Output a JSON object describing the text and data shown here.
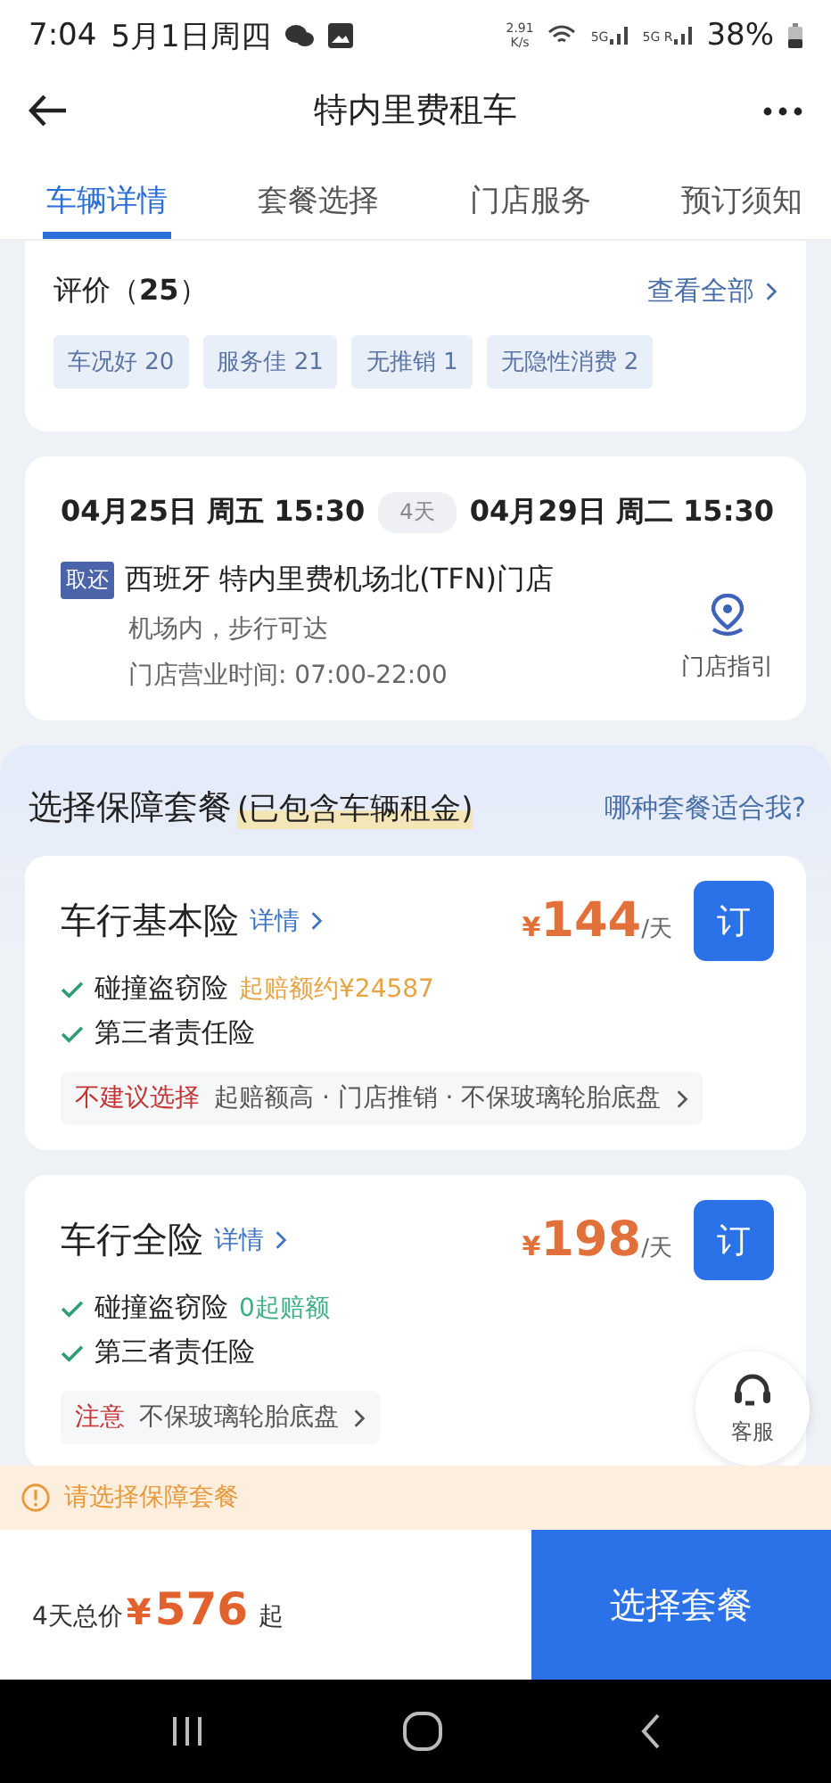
{
  "status_bar": {
    "time": "7:04",
    "date": "5月1日周四",
    "net_speed": [
      "2.91",
      "K/s"
    ],
    "signal_labels": [
      "5G",
      "5G R"
    ],
    "battery": "38%"
  },
  "header": {
    "title": "特内里费租车"
  },
  "tabs": [
    {
      "label": "车辆详情",
      "selected": true
    },
    {
      "label": "套餐选择",
      "selected": false
    },
    {
      "label": "门店服务",
      "selected": false
    },
    {
      "label": "预订须知",
      "selected": false
    }
  ],
  "reviews": {
    "title": "评价（**25**）",
    "view_all": "查看全部",
    "tags": [
      "车况好 20",
      "服务佳 21",
      "无推销 1",
      "无隐性消费 2"
    ]
  },
  "booking": {
    "pickup": "04月25日 周五 15:30",
    "duration": "4天",
    "return": "04月29日 周二 15:30",
    "badge": "取还",
    "store": "西班牙 特内里费机场北(TFN)门店",
    "notes": [
      "机场内，步行可达",
      "门店营业时间: 07:00-22:00"
    ],
    "guide": "门店指引"
  },
  "packages_section": {
    "title": "选择保障套餐",
    "highlight": "(已包含车辆租金)",
    "help": "哪种套餐适合我?"
  },
  "packages": [
    {
      "name": "车行基本险",
      "details": "详情",
      "currency": "¥",
      "price": "144",
      "unit": "/天",
      "book": "订",
      "features": [
        {
          "name": "碰撞盗窃险",
          "note": "起赔额约¥24587",
          "kind": "warning"
        },
        {
          "name": "第三者责任险"
        }
      ],
      "advice": {
        "label": "不建议选择",
        "text": "起赔额高 · 门店推销 · 不保玻璃轮胎底盘"
      }
    },
    {
      "name": "车行全险",
      "details": "详情",
      "currency": "¥",
      "price": "198",
      "unit": "/天",
      "book": "订",
      "features": [
        {
          "name": "碰撞盗窃险",
          "note": "0起赔额",
          "kind": "positive"
        },
        {
          "name": "第三者责任险"
        }
      ],
      "advice": {
        "label": "注意",
        "text": "不保玻璃轮胎底盘"
      }
    }
  ],
  "service_button": {
    "label": "客服"
  },
  "alert": {
    "text": "请选择保障套餐"
  },
  "footer": {
    "total_label": "4天总价",
    "currency": "¥",
    "total": "576",
    "suffix": "起",
    "action": "选择套餐"
  }
}
